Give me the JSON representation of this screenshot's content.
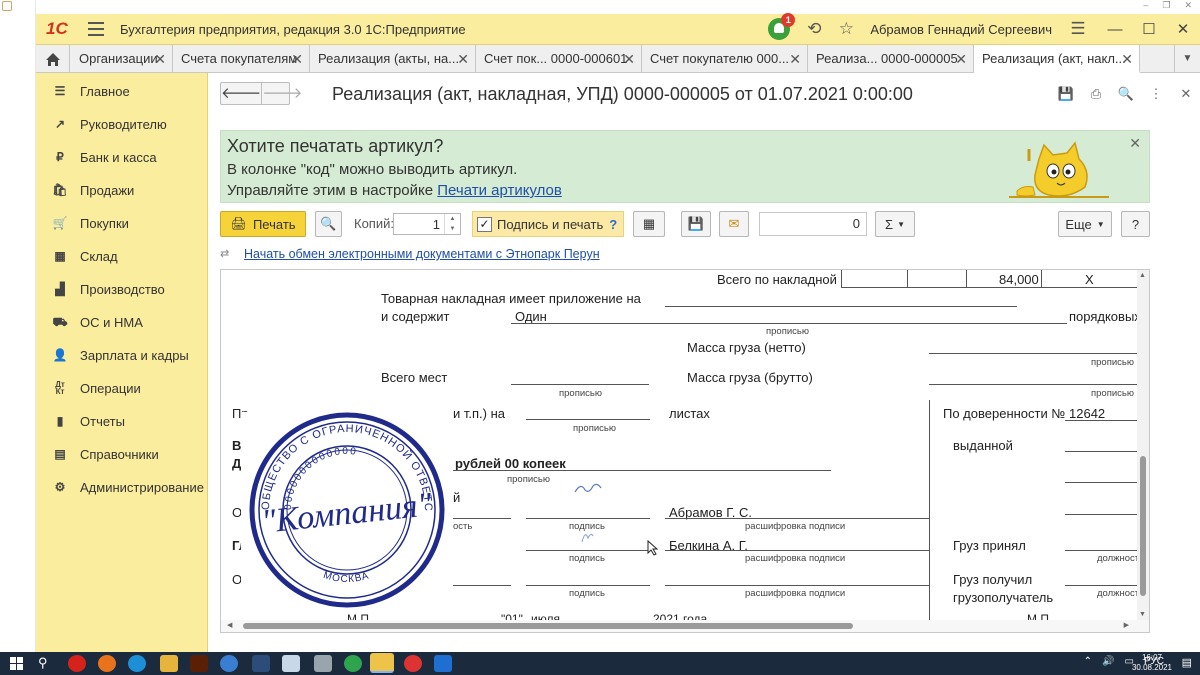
{
  "app": {
    "title": "Бухгалтерия предприятия, редакция 3.0 1С:Предприятие",
    "logo": "1С",
    "user": "Абрамов Геннадий Сергеевич",
    "notification_count": "1"
  },
  "tabs": [
    {
      "label": "Организации"
    },
    {
      "label": "Счета покупателям"
    },
    {
      "label": "Реализация (акты, на..."
    },
    {
      "label": "Счет пок... 0000-000601"
    },
    {
      "label": "Счет покупателю 000..."
    },
    {
      "label": "Реализа... 0000-000005"
    },
    {
      "label": "Реализация (акт, накл..."
    }
  ],
  "sidebar": {
    "items": [
      {
        "label": "Главное",
        "icon": "menu-icon"
      },
      {
        "label": "Руководителю",
        "icon": "trend-icon"
      },
      {
        "label": "Банк и касса",
        "icon": "ruble-icon"
      },
      {
        "label": "Продажи",
        "icon": "cart-icon"
      },
      {
        "label": "Покупки",
        "icon": "basket-icon"
      },
      {
        "label": "Склад",
        "icon": "warehouse-icon"
      },
      {
        "label": "Производство",
        "icon": "factory-icon"
      },
      {
        "label": "ОС и НМА",
        "icon": "truck-icon"
      },
      {
        "label": "Зарплата и кадры",
        "icon": "people-icon"
      },
      {
        "label": "Операции",
        "icon": "dt-kt-icon"
      },
      {
        "label": "Отчеты",
        "icon": "bar-chart-icon"
      },
      {
        "label": "Справочники",
        "icon": "book-icon"
      },
      {
        "label": "Администрирование",
        "icon": "gear-icon"
      }
    ]
  },
  "document": {
    "title": "Реализация (акт, накладная, УПД) 0000-000005 от 01.07.2021 0:00:00"
  },
  "banner": {
    "line1": "Хотите печатать артикул?",
    "line2": "В колонке \"код\" можно выводить артикул.",
    "line3_prefix": "Управляйте этим в настройке ",
    "line3_link": "Печати артикулов"
  },
  "toolbar": {
    "print_label": "Печать",
    "copies_label": "Копий:",
    "copies_value": "1",
    "sign_label": "Подпись и печать",
    "sign_help": "?",
    "sum_value": "0",
    "sigma_label": "Σ",
    "more_label": "Еще",
    "help_label": "?"
  },
  "edo_link": "Начать обмен электронными документами с Этнопарк Перун",
  "form": {
    "total_label": "Всего по накладной",
    "total_value": "84,000",
    "total_x": "X",
    "app_text1": "Товарная накладная имеет приложение на",
    "app_text2": "и содержит",
    "app_value": "Один",
    "app_suffix": "порядковых",
    "propisyu": "прописью",
    "mass_net": "Масса груза (нетто)",
    "mass_gross": "Масса груза (брутто)",
    "vsego_mest": "Всего мест",
    "pril_prefix": "Пр",
    "pril_text": "и т.п.) на",
    "listah": "листах",
    "doverennost_label": "По доверенности №",
    "doverennost_value": "12642",
    "vydannoy": "выданной",
    "vs_partial": "Вс",
    "de_partial": "Де",
    "rubles": "рублей 00 копеек",
    "i_partial": "й",
    "ot_partial": "От",
    "gl_partial": "Гл",
    "ot2_partial": "От",
    "dolzhnost_partial": "ость",
    "podpis": "подпись",
    "signer1": "Абрамов Г. С.",
    "signer2": "Белкина А. Г.",
    "rasshifrovka": "расшифровка подписи",
    "gruz_prinyal": "Груз принял",
    "gruz_poluchil": "Груз получил",
    "gruzopoluchatel": "грузополучатель",
    "dolzhnost": "должност",
    "mp": "М.П.",
    "date_day": "\"01\"",
    "date_month": "июля",
    "date_year": "2021 года"
  },
  "stamp": {
    "outer_text": "ОБЩЕСТВО С ОГРАНИЧЕННОЙ ОТВЕТСТВЕННОСТЬЮ ОГРН 000000000 ОГРН 0000000000000",
    "center": "\"Компания\"",
    "city": "МОСКВА",
    "numbers": "0000000000000"
  },
  "taskbar": {
    "lang": "РУС",
    "time": "16:07",
    "date": "30.08.2021"
  },
  "colors": {
    "accent_yellow": "#fbed9e",
    "print_button": "#f7d33a",
    "banner_green": "#d5ebd3",
    "link_blue": "#1f4fa8",
    "stamp_blue": "#1f2a8a"
  }
}
